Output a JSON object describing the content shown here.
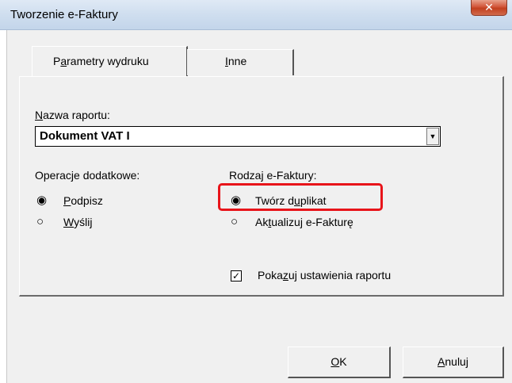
{
  "window": {
    "title": "Tworzenie e-Faktury",
    "close_glyph": "✕"
  },
  "tabs": [
    {
      "label": "Parametry wydruku",
      "accel": "a",
      "pre": "P",
      "post": "rametry wydruku",
      "active": true
    },
    {
      "label": "Inne",
      "accel": "I",
      "pre": "",
      "post": "nne",
      "active": false
    }
  ],
  "report": {
    "label_accel": "N",
    "label_rest": "azwa raportu:",
    "value": "Dokument VAT I",
    "arrow_glyph": "▼"
  },
  "extra_ops": {
    "heading": "Operacje dodatkowe:",
    "options": [
      {
        "accel": "P",
        "rest": "odpisz",
        "selected": true
      },
      {
        "accel": "W",
        "rest": "yślij",
        "selected": false
      }
    ]
  },
  "invoice_type": {
    "heading": "Rodzaj e-Faktury:",
    "options": [
      {
        "pre": "Twórz d",
        "accel": "u",
        "post": "plikat",
        "selected": true
      },
      {
        "pre": "Ak",
        "accel": "t",
        "post": "ualizuj e-Fakturę",
        "selected": false
      }
    ]
  },
  "show_settings": {
    "pre": "Poka",
    "accel": "z",
    "post": "uj ustawienia raportu",
    "checked": true,
    "check_glyph": "✓"
  },
  "buttons": {
    "ok": {
      "accel": "O",
      "rest": "K"
    },
    "cancel": {
      "accel": "A",
      "rest": "nuluj"
    }
  },
  "glyphs": {
    "radio_selected": "◉",
    "radio_unselected": "○"
  },
  "colors": {
    "highlight": "#e8141a",
    "titlebar": "#cfdeef"
  }
}
